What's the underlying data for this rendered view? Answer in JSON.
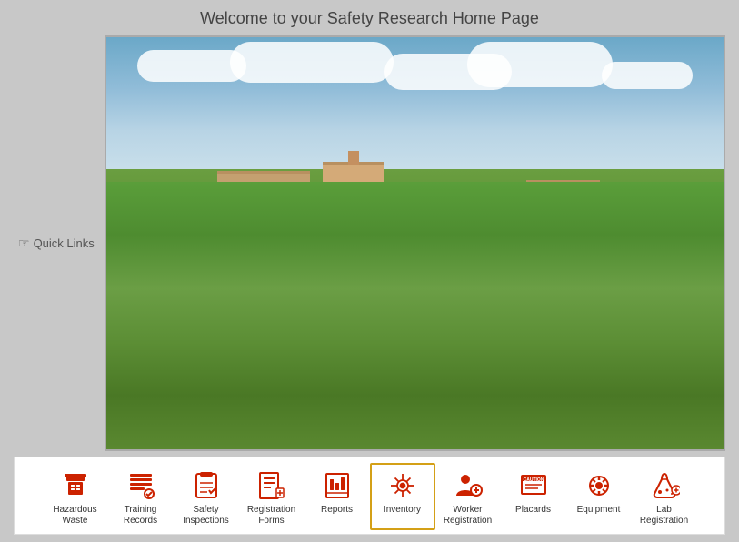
{
  "page": {
    "title": "Welcome to your Safety Research Home Page"
  },
  "quickLinks": {
    "label": "Quick Links"
  },
  "nav": {
    "items": [
      {
        "id": "hazardous-waste",
        "label": "Hazardous\nWaste",
        "label_line1": "Hazardous",
        "label_line2": "Waste",
        "active": false,
        "icon": "hazardous-waste-icon"
      },
      {
        "id": "training-records",
        "label": "Training\nRecords",
        "label_line1": "Training",
        "label_line2": "Records",
        "active": false,
        "icon": "training-records-icon"
      },
      {
        "id": "safety-inspections",
        "label": "Safety\nInspections",
        "label_line1": "Safety",
        "label_line2": "Inspections",
        "active": false,
        "icon": "safety-inspections-icon"
      },
      {
        "id": "registration-forms",
        "label": "Registration\nForms",
        "label_line1": "Registration",
        "label_line2": "Forms",
        "active": false,
        "icon": "registration-forms-icon"
      },
      {
        "id": "reports",
        "label": "Reports",
        "label_line1": "Reports",
        "label_line2": "",
        "active": false,
        "icon": "reports-icon"
      },
      {
        "id": "inventory",
        "label": "Inventory",
        "label_line1": "Inventory",
        "label_line2": "",
        "active": true,
        "icon": "inventory-icon"
      },
      {
        "id": "worker-registration",
        "label": "Worker\nRegistration",
        "label_line1": "Worker",
        "label_line2": "Registration",
        "active": false,
        "icon": "worker-registration-icon"
      },
      {
        "id": "placards",
        "label": "Placards",
        "label_line1": "Placards",
        "label_line2": "",
        "active": false,
        "icon": "placards-icon"
      },
      {
        "id": "equipment",
        "label": "Equipment",
        "label_line1": "Equipment",
        "label_line2": "",
        "active": false,
        "icon": "equipment-icon"
      },
      {
        "id": "lab-registration",
        "label": "Lab\nRegistration",
        "label_line1": "Lab",
        "label_line2": "Registration",
        "active": false,
        "icon": "lab-registration-icon"
      }
    ]
  }
}
